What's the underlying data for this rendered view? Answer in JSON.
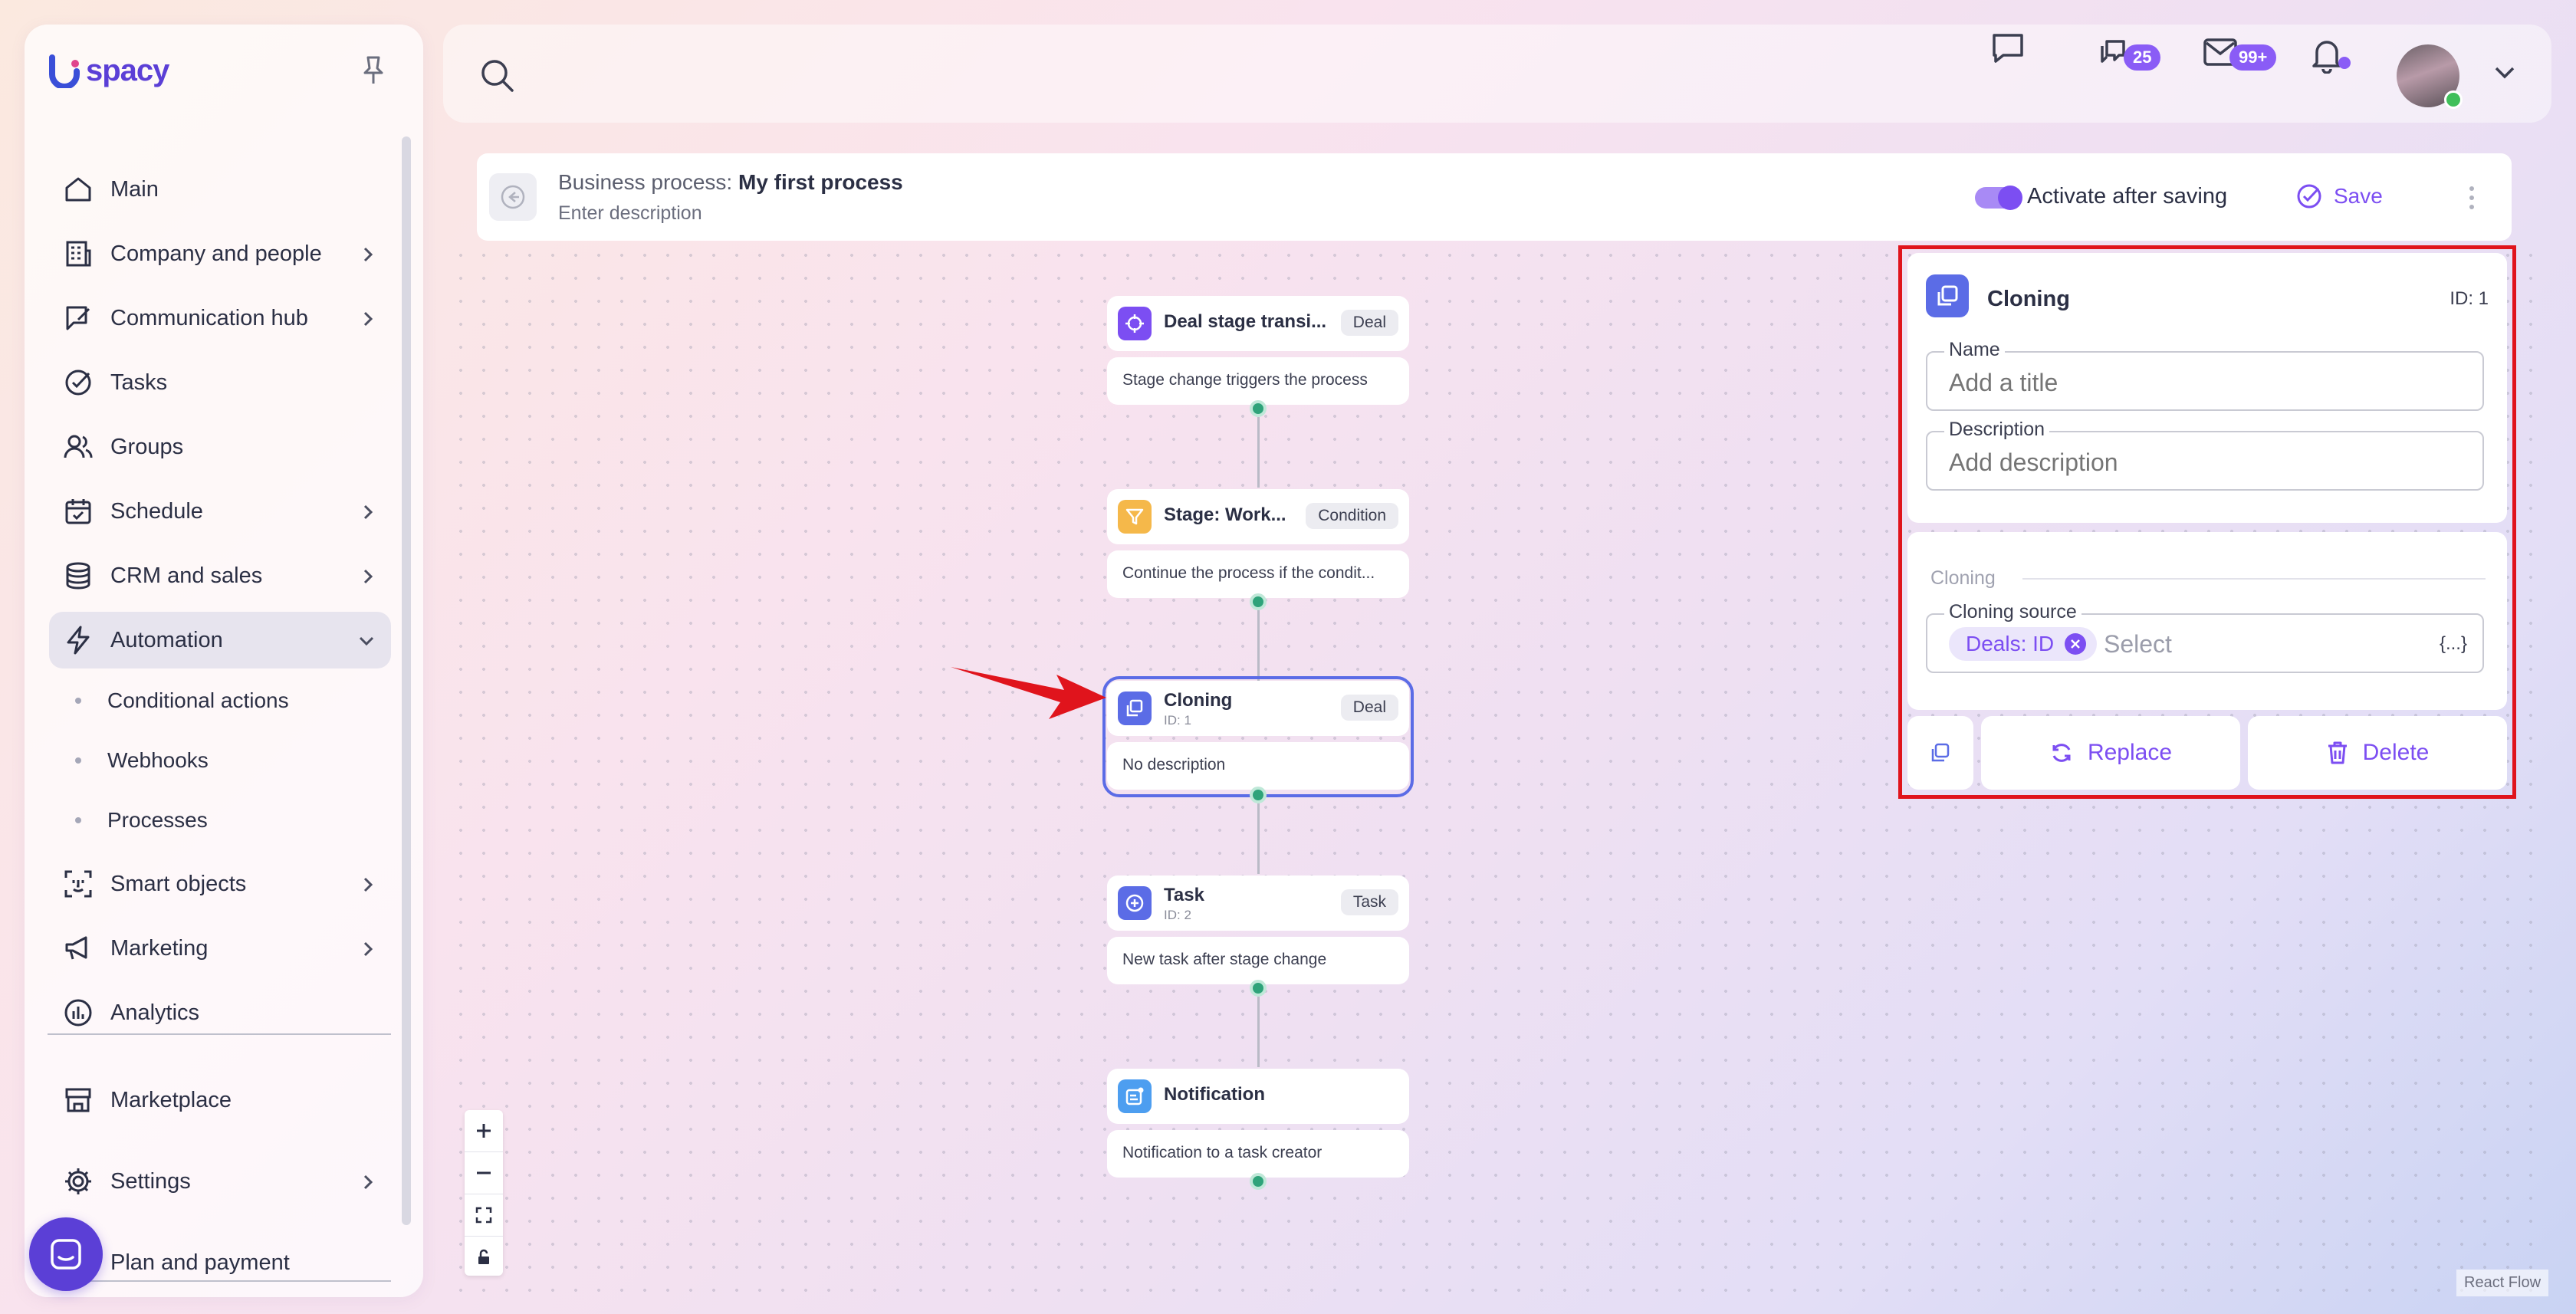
{
  "brand": {
    "logo_text": "spacy"
  },
  "sidebar": {
    "items": [
      {
        "label": "Main",
        "icon": "home-icon",
        "chevron": false
      },
      {
        "label": "Company and people",
        "icon": "building-icon",
        "chevron": true
      },
      {
        "label": "Communication hub",
        "icon": "chat-edit-icon",
        "chevron": true
      },
      {
        "label": "Tasks",
        "icon": "check-circle-icon",
        "chevron": false
      },
      {
        "label": "Groups",
        "icon": "users-icon",
        "chevron": false
      },
      {
        "label": "Schedule",
        "icon": "calendar-icon",
        "chevron": true
      },
      {
        "label": "CRM and sales",
        "icon": "database-icon",
        "chevron": true
      },
      {
        "label": "Automation",
        "icon": "lightning-icon",
        "chevron": true,
        "expanded": true
      },
      {
        "label": "Smart objects",
        "icon": "scan-face-icon",
        "chevron": true
      },
      {
        "label": "Marketing",
        "icon": "megaphone-icon",
        "chevron": true
      },
      {
        "label": "Analytics",
        "icon": "chart-circle-icon",
        "chevron": false
      },
      {
        "label": "Marketplace",
        "icon": "store-icon",
        "chevron": false
      },
      {
        "label": "Settings",
        "icon": "gear-icon",
        "chevron": true
      },
      {
        "label": "Plan and payment",
        "icon": "card-icon",
        "chevron": false
      }
    ],
    "subitems": [
      {
        "label": "Conditional actions"
      },
      {
        "label": "Webhooks"
      },
      {
        "label": "Processes"
      }
    ]
  },
  "topbar": {
    "search_placeholder": "",
    "chats_badge": "25",
    "mail_badge": "99+"
  },
  "process": {
    "prefix": "Business process:",
    "name": "My first process",
    "description_placeholder": "Enter description",
    "activate_label": "Activate after saving",
    "activate_on": true,
    "save_label": "Save"
  },
  "nodes": [
    {
      "title": "Deal stage transi...",
      "id": "",
      "tag": "Deal",
      "body": "Stage change triggers the process",
      "icon": "crosshair-icon",
      "color": "#7c4ef2"
    },
    {
      "title": "Stage: Work...",
      "id": "",
      "tag": "Condition",
      "body": "Continue the process if the condit...",
      "icon": "filter-icon",
      "color": "#f5b84a"
    },
    {
      "title": "Cloning",
      "id": "ID: 1",
      "tag": "Deal",
      "body": "No description",
      "icon": "copy-icon",
      "color": "#5b6ce6"
    },
    {
      "title": "Task",
      "id": "ID: 2",
      "tag": "Task",
      "body": "New task after stage change",
      "icon": "plus-circle-icon",
      "color": "#5b6ce6"
    },
    {
      "title": "Notification",
      "id": "",
      "tag": "",
      "body": "Notification to a task creator",
      "icon": "notification-icon",
      "color": "#4d9ef0"
    }
  ],
  "panel": {
    "title": "Cloning",
    "id": "ID: 1",
    "name_label": "Name",
    "name_placeholder": "Add a title",
    "description_label": "Description",
    "description_placeholder": "Add description",
    "section_label": "Cloning",
    "source_label": "Cloning source",
    "source_chip": "Deals: ID",
    "source_placeholder": "Select",
    "variable_icon": "{...}",
    "replace_label": "Replace",
    "delete_label": "Delete"
  },
  "canvas": {
    "attribution": "React Flow"
  },
  "colors": {
    "accent": "#7c4ef2",
    "highlight_border": "#e0141c",
    "handle": "#2fa37a"
  }
}
